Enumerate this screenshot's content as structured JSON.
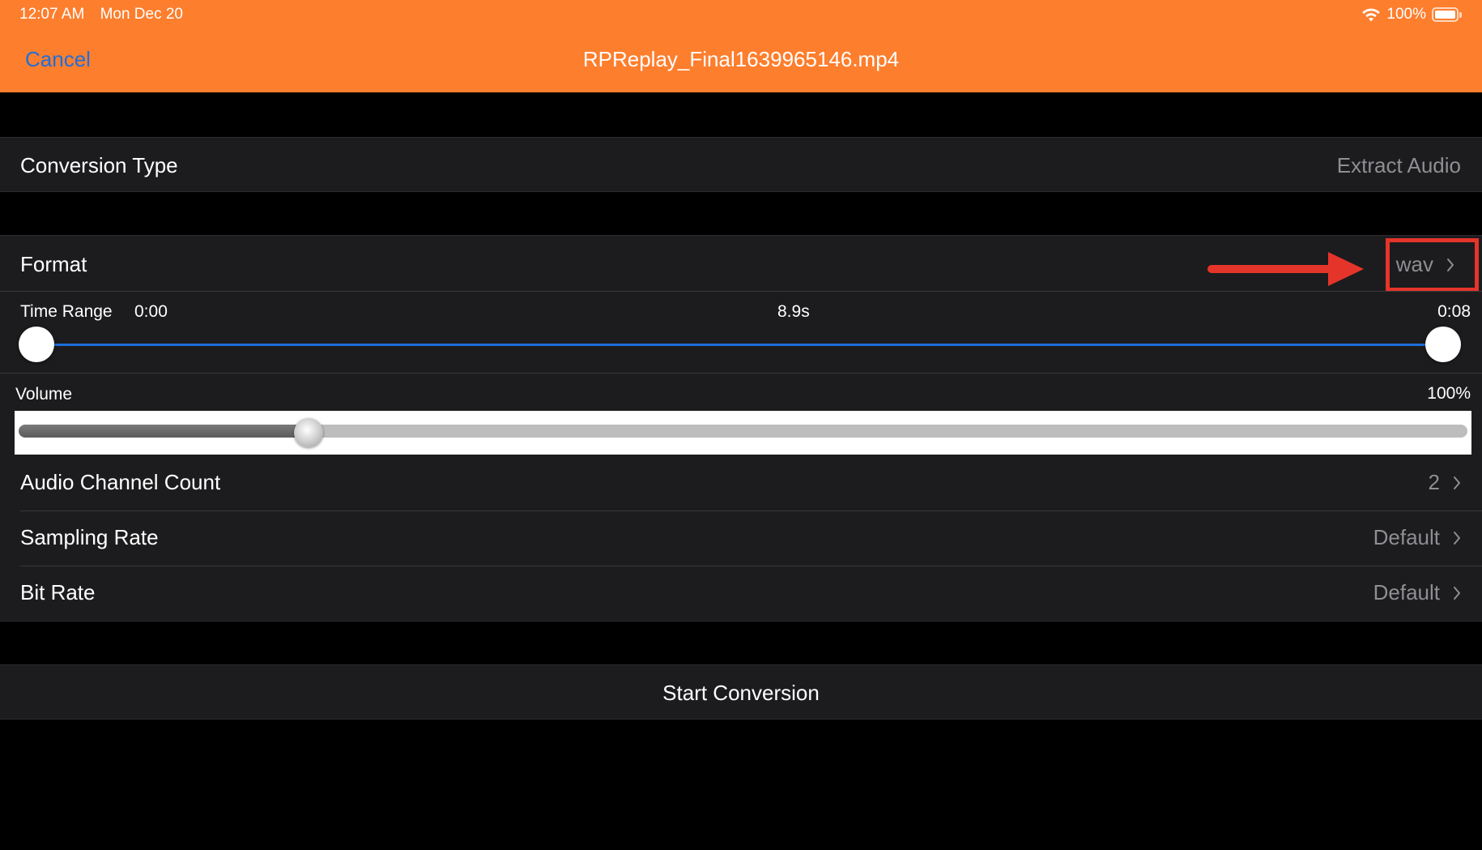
{
  "status_bar": {
    "time": "12:07 AM",
    "date": "Mon Dec 20",
    "battery": "100%"
  },
  "nav": {
    "cancel_label": "Cancel",
    "title": "RPReplay_Final1639965146.mp4"
  },
  "conversion_type": {
    "label": "Conversion Type",
    "value": "Extract Audio"
  },
  "settings": {
    "format": {
      "label": "Format",
      "value": "wav"
    },
    "time_range": {
      "label": "Time Range",
      "start": "0:00",
      "duration": "8.9s",
      "end": "0:08",
      "start_fraction": 0,
      "end_fraction": 1
    },
    "volume": {
      "label": "Volume",
      "value": "100%",
      "slider_fraction": 0.2
    },
    "audio_channel_count": {
      "label": "Audio Channel Count",
      "value": "2"
    },
    "sampling_rate": {
      "label": "Sampling Rate",
      "value": "Default"
    },
    "bit_rate": {
      "label": "Bit Rate",
      "value": "Default"
    }
  },
  "actions": {
    "start_label": "Start Conversion"
  },
  "colors": {
    "header": "#FD7E2D",
    "link": "#1E6FD9",
    "annotation": "#E5342A",
    "cell": "#1C1C1E",
    "secondary_text": "#8E8E93"
  },
  "icons": [
    "wifi-icon",
    "battery-icon",
    "chevron-right-icon",
    "arrow-right-annotation"
  ]
}
